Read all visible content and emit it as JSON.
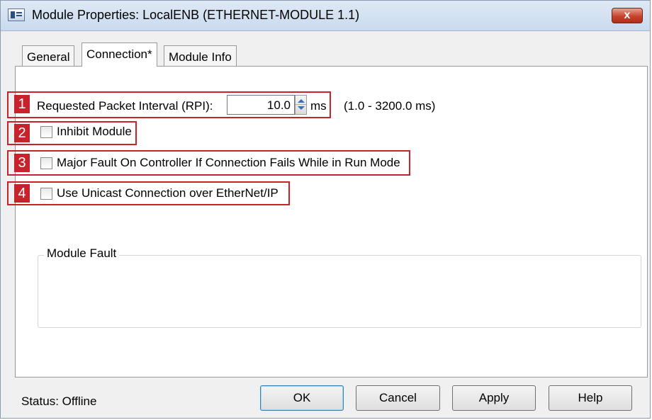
{
  "window": {
    "title": "Module Properties: LocalENB (ETHERNET-MODULE 1.1)",
    "close_glyph": "x"
  },
  "tabs": [
    {
      "label": "General",
      "active": false
    },
    {
      "label": "Connection*",
      "active": true
    },
    {
      "label": "Module Info",
      "active": false
    }
  ],
  "connection": {
    "rpi_label": "Requested Packet Interval (RPI):",
    "rpi_value": "10.0",
    "rpi_unit": "ms",
    "rpi_range": "(1.0 - 3200.0 ms)",
    "inhibit_label": "Inhibit Module",
    "inhibit_checked": false,
    "major_fault_label": "Major Fault On Controller If Connection Fails While in Run Mode",
    "major_fault_checked": false,
    "unicast_label": "Use Unicast Connection over EtherNet/IP",
    "unicast_checked": false
  },
  "callouts": [
    "1",
    "2",
    "3",
    "4"
  ],
  "callout_color": "#c8232c",
  "module_fault": {
    "title": "Module Fault"
  },
  "status": {
    "text": "Status:  Offline"
  },
  "buttons": {
    "ok": "OK",
    "cancel": "Cancel",
    "apply": "Apply",
    "help": "Help"
  },
  "icons": {
    "app": "module-properties-icon",
    "close": "close-icon",
    "spin_up": "spin-up-icon",
    "spin_down": "spin-down-icon"
  }
}
